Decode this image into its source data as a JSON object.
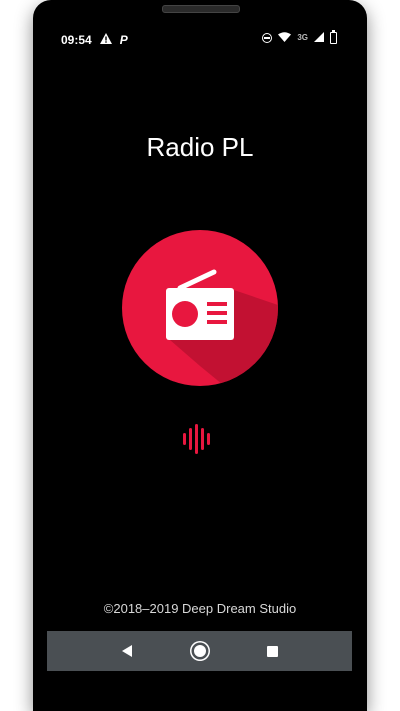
{
  "status_bar": {
    "time": "09:54",
    "alert_icon": "warning-triangle-icon",
    "parking_icon": "P",
    "dnd_icon": "do-not-disturb-icon",
    "wifi_icon": "wifi-icon",
    "network_label": "3G",
    "signal_icon": "cell-signal-icon",
    "battery_icon": "battery-icon"
  },
  "app": {
    "title": "Radio PL",
    "logo_icon": "radio-icon",
    "wave_icon": "audio-wave-icon",
    "copyright": "©2018–2019 Deep Dream Studio"
  },
  "colors": {
    "background": "#000000",
    "accent": "#e8173f",
    "nav_bar": "#4a4f53"
  },
  "navigation": {
    "back_icon": "back-triangle-icon",
    "home_icon": "home-circle-icon",
    "recents_icon": "recents-square-icon"
  }
}
